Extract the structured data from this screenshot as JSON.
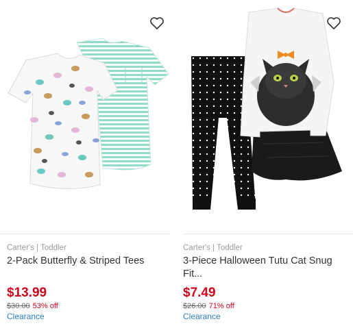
{
  "products": [
    {
      "brand": "Carter's | Toddler",
      "title": "2-Pack Butterfly & Striped Tees",
      "price": "$13.99",
      "original_price": "$30.00",
      "discount": "53% off",
      "badge": "Clearance"
    },
    {
      "brand": "Carter's | Toddler",
      "title": "3-Piece Halloween Tutu Cat Snug Fit...",
      "price": "$7.49",
      "original_price": "$26.00",
      "discount": "71% off",
      "badge": "Clearance"
    }
  ],
  "colors": {
    "sale_price": "#d0021b",
    "clearance_link": "#2a7dc4",
    "stripe_tee": "#8fdcc8",
    "pajama_black": "#111111"
  },
  "icons": {
    "favorite": "heart-outline-icon"
  }
}
